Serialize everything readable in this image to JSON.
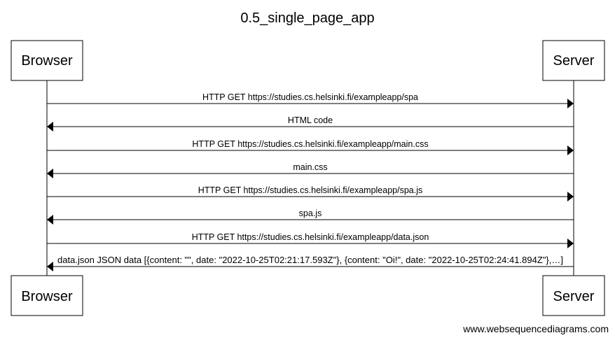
{
  "title": "0.5_single_page_app",
  "participants": [
    {
      "id": "browser",
      "label": "Browser"
    },
    {
      "id": "server",
      "label": "Server"
    }
  ],
  "messages": [
    {
      "from": "browser",
      "to": "server",
      "text": "HTTP GET https://studies.cs.helsinki.fi/exampleapp/spa"
    },
    {
      "from": "server",
      "to": "browser",
      "text": "HTML code"
    },
    {
      "from": "browser",
      "to": "server",
      "text": "HTTP GET https://studies.cs.helsinki.fi/exampleapp/main.css"
    },
    {
      "from": "server",
      "to": "browser",
      "text": "main.css"
    },
    {
      "from": "browser",
      "to": "server",
      "text": "HTTP GET https://studies.cs.helsinki.fi/exampleapp/spa.js"
    },
    {
      "from": "server",
      "to": "browser",
      "text": "spa.js"
    },
    {
      "from": "browser",
      "to": "server",
      "text": "HTTP GET https://studies.cs.helsinki.fi/exampleapp/data.json"
    },
    {
      "from": "server",
      "to": "browser",
      "text": "data.json JSON data [{content: \"\", date: \"2022-10-25T02:21:17.593Z\"}, {content: \"Oi!\", date: \"2022-10-25T02:24:41.894Z\"},…]"
    }
  ],
  "footer": "www.websequencediagrams.com"
}
